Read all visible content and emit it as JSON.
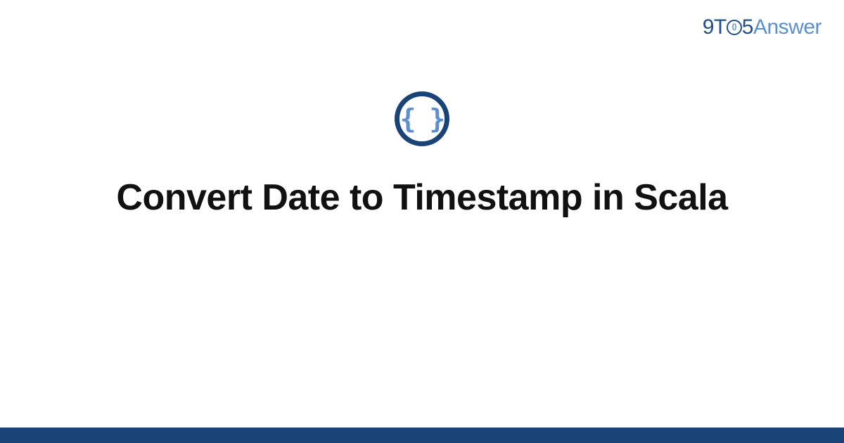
{
  "logo": {
    "part1": "9T",
    "part_inner": "{}",
    "part2": "5",
    "part3": "Answer"
  },
  "icon": {
    "glyph": "{ }",
    "name": "code-braces-icon"
  },
  "title": "Convert Date to Timestamp in Scala",
  "colors": {
    "dark_blue": "#1a4478",
    "light_blue": "#5b8fd1"
  }
}
